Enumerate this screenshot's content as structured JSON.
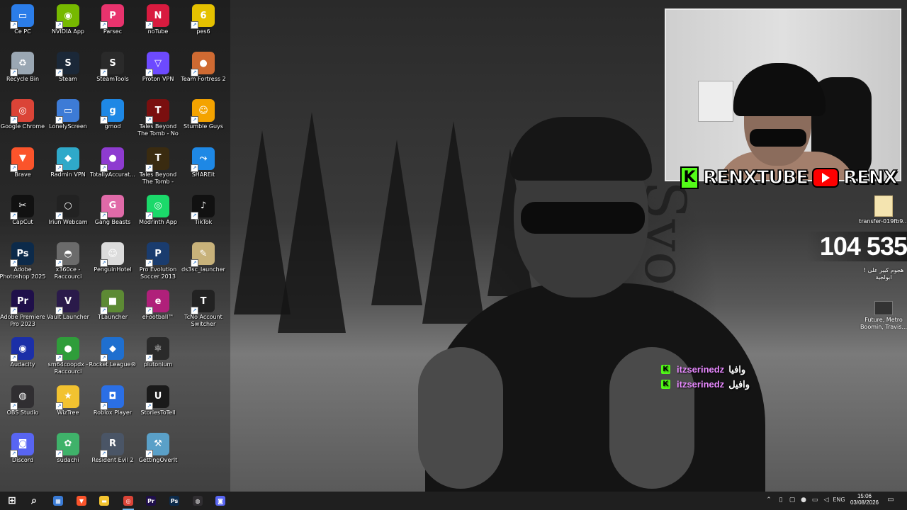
{
  "desktop": {
    "icons": [
      {
        "label": "Ce PC",
        "icon": "computer-icon",
        "color": "#2b7de9",
        "glyph": "▭"
      },
      {
        "label": "NVIDIA App",
        "icon": "nvidia-icon",
        "color": "#76b900",
        "glyph": "◉"
      },
      {
        "label": "Parsec",
        "icon": "parsec-icon",
        "color": "#e8336d",
        "glyph": "P"
      },
      {
        "label": "noTube",
        "icon": "notube-icon",
        "color": "#d81b3f",
        "glyph": "N"
      },
      {
        "label": "pes6",
        "icon": "pes6-icon",
        "color": "#e5c100",
        "glyph": "6"
      },
      {
        "label": "Recycle Bin",
        "icon": "recycle-bin-icon",
        "color": "#9aa7b3",
        "glyph": "♻"
      },
      {
        "label": "Steam",
        "icon": "steam-icon",
        "color": "#1b2838",
        "glyph": "S"
      },
      {
        "label": "SteamTools",
        "icon": "steamtools-icon",
        "color": "#2a2a2a",
        "glyph": "S"
      },
      {
        "label": "Proton VPN",
        "icon": "protonvpn-icon",
        "color": "#6d4aff",
        "glyph": "▽"
      },
      {
        "label": "Team Fortress 2",
        "icon": "tf2-icon",
        "color": "#cf6a32",
        "glyph": "●"
      },
      {
        "label": "Google Chrome",
        "icon": "chrome-icon",
        "color": "#db4437",
        "glyph": "◎"
      },
      {
        "label": "LonelyScreen",
        "icon": "lonelyscreen-icon",
        "color": "#3d7bd6",
        "glyph": "▭"
      },
      {
        "label": "gmod",
        "icon": "gmod-icon",
        "color": "#1e88e5",
        "glyph": "g"
      },
      {
        "label": "Tales Beyond The Tomb - No Wit...",
        "icon": "tbtt-icon",
        "color": "#7a0f0f",
        "glyph": "T"
      },
      {
        "label": "Stumble Guys",
        "icon": "stumble-guys-icon",
        "color": "#f4a300",
        "glyph": "☺"
      },
      {
        "label": "Brave",
        "icon": "brave-icon",
        "color": "#fb542b",
        "glyph": "▼"
      },
      {
        "label": "Radmin VPN",
        "icon": "radmin-icon",
        "color": "#2fa9c9",
        "glyph": "◆"
      },
      {
        "label": "TotallyAccurat...",
        "icon": "tabs-icon",
        "color": "#8e3bd0",
        "glyph": "●"
      },
      {
        "label": "Tales Beyond The Tomb - Pinevill...",
        "icon": "tbtt-ep1-icon",
        "color": "#3a2b10",
        "glyph": "T"
      },
      {
        "label": "SHAREit",
        "icon": "shareit-icon",
        "color": "#1e88e5",
        "glyph": "⤳"
      },
      {
        "label": "CapCut",
        "icon": "capcut-icon",
        "color": "#111111",
        "glyph": "✂"
      },
      {
        "label": "Iriun Webcam",
        "icon": "iriun-icon",
        "color": "#222222",
        "glyph": "○"
      },
      {
        "label": "Gang Beasts",
        "icon": "gang-beasts-icon",
        "color": "#e06aa8",
        "glyph": "G"
      },
      {
        "label": "Modrinth App",
        "icon": "modrinth-icon",
        "color": "#1bd96a",
        "glyph": "◎"
      },
      {
        "label": "TikTok",
        "icon": "tiktok-icon",
        "color": "#111111",
        "glyph": "♪"
      },
      {
        "label": "Adobe Photoshop 2025",
        "icon": "photoshop-icon",
        "color": "#0c2a4a",
        "glyph": "Ps"
      },
      {
        "label": "x360ce - Raccourci",
        "icon": "gamepad-icon",
        "color": "#6b6b6b",
        "glyph": "◓"
      },
      {
        "label": "PenguinHotel",
        "icon": "penguinhotel-icon",
        "color": "#dcdcdc",
        "glyph": "☺"
      },
      {
        "label": "Pro Evolution Soccer 2013",
        "icon": "pes2013-icon",
        "color": "#1a3c6e",
        "glyph": "P"
      },
      {
        "label": "ds3sc_launcher",
        "icon": "ds3sc-icon",
        "color": "#c8b27a",
        "glyph": "✎"
      },
      {
        "label": "Adobe Premiere Pro 2023",
        "icon": "premiere-icon",
        "color": "#1f0f4a",
        "glyph": "Pr"
      },
      {
        "label": "Vault Launcher",
        "icon": "vault-launcher-icon",
        "color": "#2a1a4a",
        "glyph": "V"
      },
      {
        "label": "TLauncher",
        "icon": "tlauncher-icon",
        "color": "#5d8a34",
        "glyph": "■"
      },
      {
        "label": "eFootball™",
        "icon": "efootball-icon",
        "color": "#b0207a",
        "glyph": "e"
      },
      {
        "label": "TcNo Account Switcher",
        "icon": "tcno-icon",
        "color": "#222222",
        "glyph": "T"
      },
      {
        "label": "Audacity",
        "icon": "audacity-icon",
        "color": "#1b2fa8",
        "glyph": "◉"
      },
      {
        "label": "sm64coopdx - Raccourci",
        "icon": "sm64-icon",
        "color": "#2f9d3a",
        "glyph": "●"
      },
      {
        "label": "Rocket League®",
        "icon": "rocket-league-icon",
        "color": "#1f6fcf",
        "glyph": "◆"
      },
      {
        "label": "plutonium",
        "icon": "plutonium-icon",
        "color": "#2a2a2a",
        "glyph": "⚛"
      },
      {
        "label": "",
        "icon": "",
        "color": "",
        "glyph": ""
      },
      {
        "label": "OBS Studio",
        "icon": "obs-icon",
        "color": "#302e31",
        "glyph": "◍"
      },
      {
        "label": "WizTree",
        "icon": "wiztree-icon",
        "color": "#f2c230",
        "glyph": "★"
      },
      {
        "label": "Roblox Player",
        "icon": "roblox-icon",
        "color": "#2b6fe5",
        "glyph": "◘"
      },
      {
        "label": "StoriesToTell",
        "icon": "unreal-icon",
        "color": "#1a1a1a",
        "glyph": "U"
      },
      {
        "label": "",
        "icon": "",
        "color": "",
        "glyph": ""
      },
      {
        "label": "Discord",
        "icon": "discord-icon",
        "color": "#5865f2",
        "glyph": "◙"
      },
      {
        "label": "sudachi",
        "icon": "sudachi-icon",
        "color": "#3fb26a",
        "glyph": "✿"
      },
      {
        "label": "Resident Evil 2",
        "icon": "re2-icon",
        "color": "#4a5566",
        "glyph": "R"
      },
      {
        "label": "GettingOverIt",
        "icon": "gettingoverit-icon",
        "color": "#5aa0c8",
        "glyph": "⚒"
      }
    ],
    "right_icons": [
      {
        "label": "transfer-019fb9...",
        "icon": "folder-icon"
      },
      {
        "label": "هجوم كبير على ! ابولجية",
        "icon": "video-file-icon"
      },
      {
        "label": "Future, Metro Boomin, Travis...",
        "icon": "music-file-icon"
      }
    ]
  },
  "wallpaper": {
    "watermark": "Syoau"
  },
  "stream": {
    "brand_kick": "RENXTUBE",
    "brand_youtube": "RENX",
    "kick_letter": "K",
    "counter": "104 535",
    "chat": [
      {
        "badge": "K",
        "user": "itzserinedz",
        "message": "وافيا"
      },
      {
        "badge": "K",
        "user": "itzserinedz",
        "message": "وافيل"
      }
    ]
  },
  "taskbar": {
    "apps": [
      {
        "name": "start",
        "icon": "windows-start-icon",
        "glyph": "⊞",
        "color": "#ffffff"
      },
      {
        "name": "search",
        "icon": "search-icon",
        "glyph": "⌕",
        "color": "#ffffff"
      },
      {
        "name": "store",
        "icon": "store-icon",
        "glyph": "▦",
        "color": "#3a7bd5"
      },
      {
        "name": "brave",
        "icon": "brave-icon",
        "glyph": "▼",
        "color": "#fb542b"
      },
      {
        "name": "explorer",
        "icon": "folder-icon",
        "glyph": "▬",
        "color": "#f4c430"
      },
      {
        "name": "chrome",
        "icon": "chrome-icon",
        "glyph": "◎",
        "color": "#db4437"
      },
      {
        "name": "premiere",
        "icon": "premiere-icon",
        "glyph": "Pr",
        "color": "#1f0f4a"
      },
      {
        "name": "photoshop",
        "icon": "photoshop-icon",
        "glyph": "Ps",
        "color": "#0c2a4a"
      },
      {
        "name": "obs",
        "icon": "obs-icon",
        "glyph": "◍",
        "color": "#302e31"
      },
      {
        "name": "discord",
        "icon": "discord-icon",
        "glyph": "◙",
        "color": "#5865f2"
      }
    ],
    "tray": {
      "language": "ENG",
      "time": "15:06",
      "date": "03/08/2026"
    }
  }
}
